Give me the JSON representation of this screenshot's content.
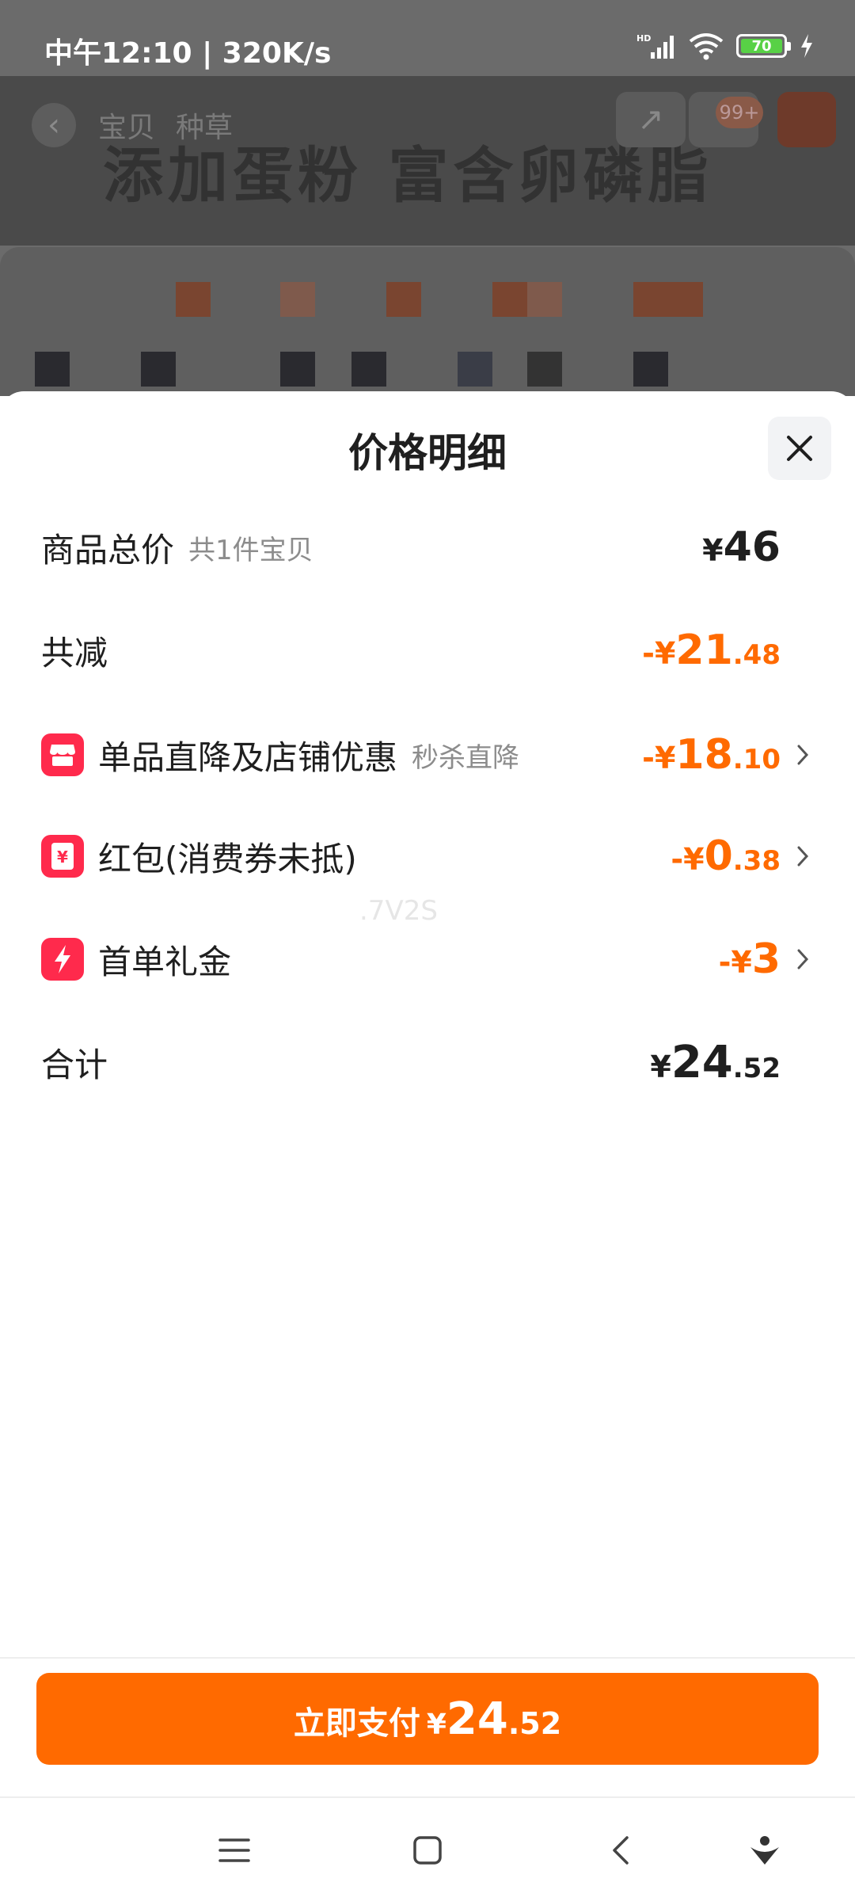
{
  "status_bar": {
    "time": "中午12:10 | 320K/s",
    "battery": "70",
    "icons": [
      "hd-signal-icon",
      "wifi-icon",
      "battery-icon",
      "charging-icon"
    ]
  },
  "background_page": {
    "tabs": [
      "宝贝",
      "种草"
    ],
    "headline": "添加蛋粉 富含卵磷脂",
    "cart_badge": "99+"
  },
  "sheet": {
    "title": "价格明细",
    "rows": [
      {
        "label": "商品总价",
        "sub": "共1件宝贝",
        "sign": "¥",
        "int": "46",
        "dec": "",
        "color": "black"
      },
      {
        "label": "共减",
        "sub": "",
        "sign": "-¥",
        "int": "21",
        "dec": ".48",
        "color": "orange"
      },
      {
        "label": "单品直降及店铺优惠",
        "sub": "秒杀直降",
        "icon": "shop-icon",
        "sign": "-¥",
        "int": "18",
        "dec": ".10",
        "color": "orange"
      },
      {
        "label": "红包(消费券未抵)",
        "sub": "",
        "icon": "red-packet-icon",
        "sign": "-¥",
        "int": "0",
        "dec": ".38",
        "color": "orange"
      },
      {
        "label": "首单礼金",
        "sub": "",
        "icon": "lightning-icon",
        "sign": "-¥",
        "int": "3",
        "dec": "",
        "color": "orange"
      },
      {
        "label": "合计",
        "sub": "",
        "sign": "¥",
        "int": "24",
        "dec": ".52",
        "color": "black"
      }
    ],
    "watermark": ".7V2S"
  },
  "pay_button": {
    "label": "立即支付",
    "sign": "¥",
    "int": "24",
    "dec": ".52"
  },
  "colors": {
    "accent": "#ff6a00",
    "icon_bg": "#ff2a4c",
    "text": "#1f1f1f",
    "muted": "#8c8c8c"
  }
}
